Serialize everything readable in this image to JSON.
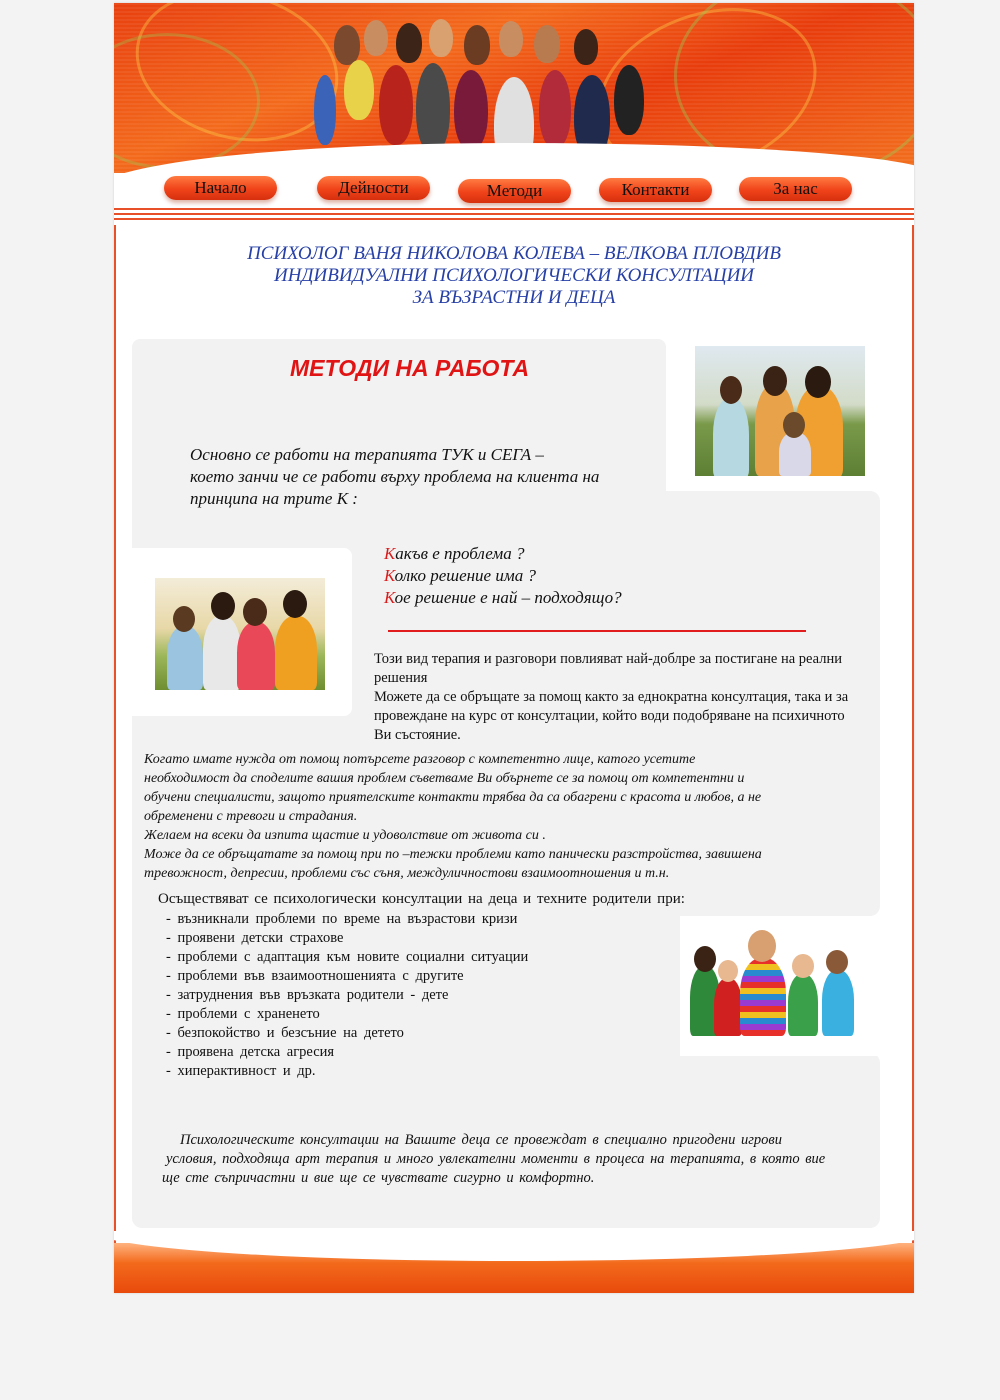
{
  "nav": {
    "items": [
      "Начало",
      "Дейности",
      "Методи",
      "Контакти",
      "За нас"
    ]
  },
  "site_title": {
    "line1": "ПСИХОЛОГ ВАНЯ НИКОЛОВА КОЛЕВА – ВЕЛКОВА  ПЛОВДИВ",
    "line2": "ИНДИВИДУАЛНИ ПСИХОЛОГИЧЕСКИ КОНСУЛТАЦИИ",
    "line3": "ЗА ВЪЗРАСТНИ И ДЕЦА"
  },
  "methods": {
    "title": "МЕТОДИ НА РАБОТА",
    "intro_line1": "Основно се работи на терапията ТУК и СЕГА –",
    "intro_line2": "което занчи че се работи върху проблема на клиента на",
    "intro_line3": " принципа на трите К :",
    "k_items": [
      {
        "first": "К",
        "rest": "акъв е проблема ?"
      },
      {
        "first": "К",
        "rest": "олко решение има ?"
      },
      {
        "first": "К",
        "rest": "ое решение е най – подходящо?"
      }
    ]
  },
  "para1": {
    "line1": "  Този вид терапия и разговори повлияват най-доблре за постигане на реални решения",
    "line2": "  Можете да се обръщате за помощ както за еднократна консултация, така и за провеждане на курс от консултации, който води подобряване на психичното Ви състояние."
  },
  "para2": {
    "lines": [
      "   Когато имате нужда от помощ потърсете разговор с компетентно лице, катого усетите",
      "необходимост да споделите вашия проблем съветваме Ви обърнете се за помощ от компетентни и",
      "обучени специалисти, защото приятелските контакти трябва да са обагрени с красота и любов, а не",
      " обременени с тревоги и страдания.",
      "   Желаем на всеки да изпита щастие и удоволствие от живота си .",
      "    Може да се обръщатате за помощ при по –тежки проблеми като панически разстройства, завишена",
      " тревожност, депресии, проблеми със съня, междуличностови взаимоотношения и т.н."
    ]
  },
  "consultations": {
    "heading": "Осъществяват  се психологически  консултации  на  деца  и  техните  родители  при:",
    "items": [
      "-  възникнали  проблеми  по  време  на  възрастови  кризи",
      "-  проявени  детски  страхове",
      "-  проблеми  с  адаптация  към  новите  социални  ситуации",
      "-  проблеми  във  взаимоотношенията  с  другите",
      "-  затруднения  във  връзката  родители  -  дете",
      "-  проблеми  с  храненето",
      "-  безпокойство  и  безсъние  на  детето",
      "-  проявена  детска  агресия",
      "-  хиперактивност  и  др."
    ]
  },
  "closing": {
    "lines": [
      "Психологическите  консултации  на  Вашите  деца   се  провеждат  в  специално  пригодени  игрови",
      "условия, подходяща арт терапия и много увлекателни моменти в процеса на терапията, в която вие",
      "ще сте съпричастни и  вие  ще  се  чувствате  сигурно  и  комфортно."
    ]
  },
  "colors": {
    "accent": "#e8502a",
    "title_blue": "#2740a6",
    "heading_red": "#e01414"
  }
}
